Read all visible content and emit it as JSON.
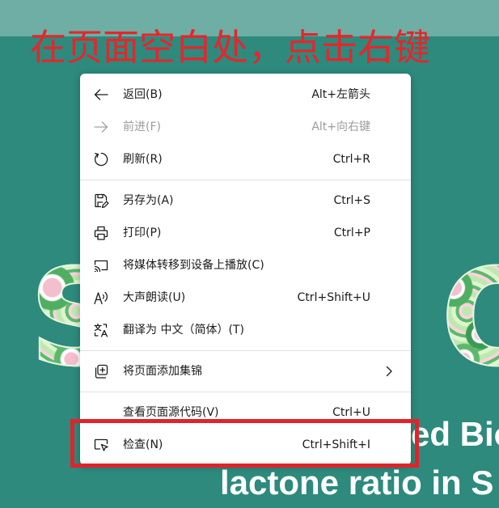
{
  "annotation": {
    "text": "在页面空白处，点击右键",
    "color": "#e5262c"
  },
  "colors": {
    "page_background": "#2d8a7d",
    "top_band": "#6eaea4",
    "highlight_frame": "#e2222a"
  },
  "page": {
    "hero_letters": {
      "left": "S",
      "right": "O"
    },
    "heading_line1": "ed Bio",
    "heading_line2": "lactone ratio in S"
  },
  "context_menu": {
    "items": [
      {
        "label": "返回(B)",
        "shortcut": "Alt+左箭头",
        "icon": "back-arrow-icon"
      },
      {
        "label": "前进(F)",
        "shortcut": "Alt+向右键",
        "icon": "forward-arrow-icon",
        "disabled": true
      },
      {
        "label": "刷新(R)",
        "shortcut": "Ctrl+R",
        "icon": "refresh-icon"
      },
      {
        "label": "另存为(A)",
        "shortcut": "Ctrl+S",
        "icon": "save-as-icon"
      },
      {
        "label": "打印(P)",
        "shortcut": "Ctrl+P",
        "icon": "print-icon"
      },
      {
        "label": "将媒体转移到设备上播放(C)",
        "icon": "cast-icon"
      },
      {
        "label": "大声朗读(U)",
        "shortcut": "Ctrl+Shift+U",
        "icon": "read-aloud-icon"
      },
      {
        "label": "翻译为 中文（简体）(T)",
        "icon": "translate-icon"
      },
      {
        "label": "将页面添加集锦",
        "icon": "collections-add-icon",
        "has_submenu": true
      },
      {
        "label": "查看页面源代码(V)",
        "shortcut": "Ctrl+U"
      },
      {
        "label": "检查(N)",
        "shortcut": "Ctrl+Shift+I",
        "icon": "inspect-icon",
        "highlighted": true
      }
    ]
  }
}
